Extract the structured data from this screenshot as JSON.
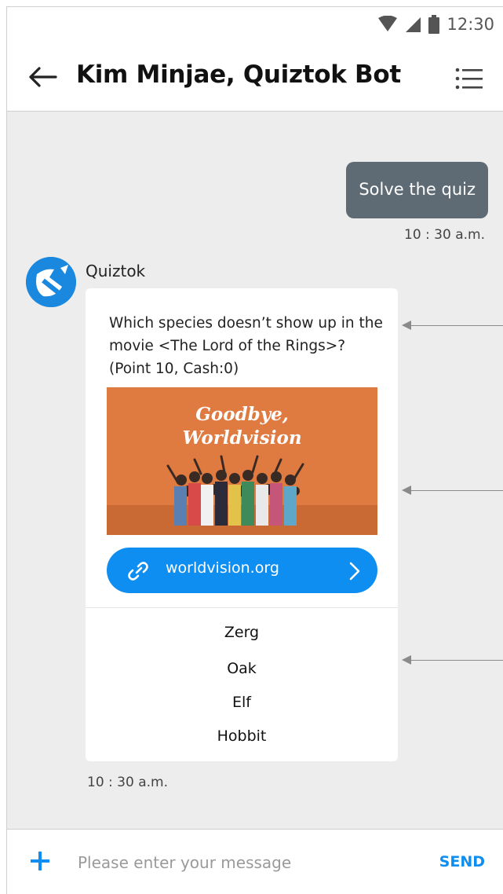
{
  "status_bar": {
    "time": "12:30"
  },
  "header": {
    "title": "Kim Minjae, Quiztok Bot"
  },
  "messages": {
    "outgoing": {
      "text": "Solve the quiz",
      "time": "10 : 30 a.m."
    },
    "incoming": {
      "sender": "Quiztok",
      "question": "Which species doesn’t show up in the movie <The Lord of the Rings>? (Point 10, Cash:0)",
      "media_line1": "Goodbye,",
      "media_line2": "Worldvision",
      "link_text": "worldvision.org",
      "options": [
        "Zerg",
        "Oak",
        "Elf",
        "Hobbit"
      ],
      "time": "10 : 30 a.m."
    }
  },
  "input_bar": {
    "placeholder": "Please enter your message",
    "send_label": "SEND"
  },
  "colors": {
    "accent": "#0f8ef1",
    "outgoing_bubble": "#5f6b74",
    "chat_background": "#ededed"
  },
  "icons": [
    "wifi-icon",
    "signal-icon",
    "battery-icon",
    "back-arrow-icon",
    "list-menu-icon",
    "quiztok-logo-icon",
    "link-icon",
    "chevron-right-icon",
    "plus-icon"
  ]
}
